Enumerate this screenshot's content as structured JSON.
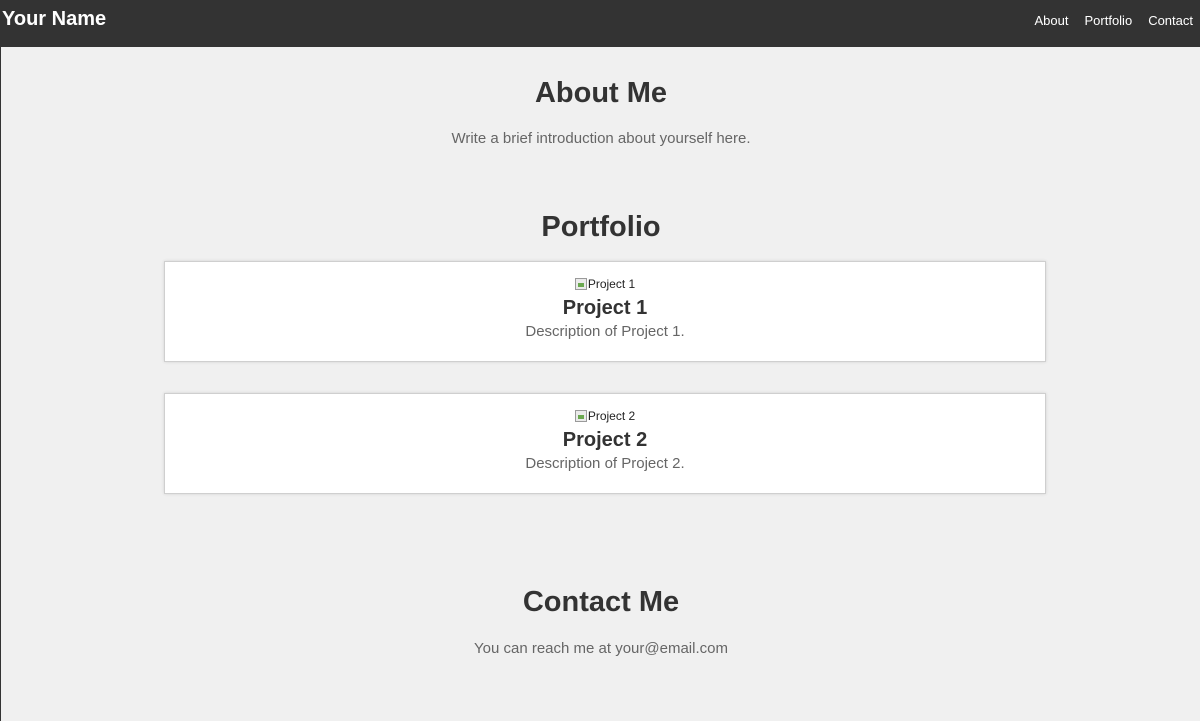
{
  "header": {
    "brand": "Your Name",
    "nav": [
      "About",
      "Portfolio",
      "Contact"
    ]
  },
  "about": {
    "title": "About Me",
    "text": "Write a brief introduction about yourself here."
  },
  "portfolio": {
    "title": "Portfolio",
    "projects": [
      {
        "image_alt": "Project 1",
        "title": "Project 1",
        "description": "Description of Project 1."
      },
      {
        "image_alt": "Project 2",
        "title": "Project 2",
        "description": "Description of Project 2."
      }
    ]
  },
  "contact": {
    "title": "Contact Me",
    "text": "You can reach me at your@email.com"
  },
  "colors": {
    "header_bg": "#333333",
    "page_bg": "#f0f0f0",
    "heading": "#333333",
    "body_text": "#666666"
  }
}
